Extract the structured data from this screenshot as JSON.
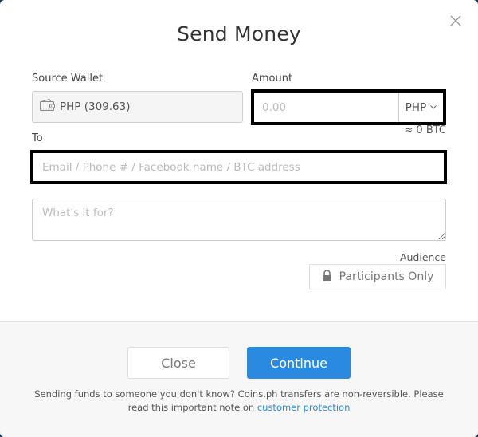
{
  "modal": {
    "title": "Send Money",
    "close_icon": "close-icon"
  },
  "form": {
    "source_wallet": {
      "label": "Source Wallet",
      "icon": "wallet-icon",
      "value": "PHP (309.63)"
    },
    "amount": {
      "label": "Amount",
      "placeholder": "0.00",
      "value": "",
      "currency": "PHP",
      "currency_icon": "chevron-down-icon",
      "btc_approx": "≈ 0 BTC"
    },
    "to": {
      "label": "To",
      "placeholder": "Email / Phone # / Facebook name / BTC address",
      "value": ""
    },
    "note": {
      "placeholder": "What's it for?",
      "value": ""
    },
    "audience": {
      "label": "Audience",
      "icon": "lock-icon",
      "value": "Participants Only"
    }
  },
  "footer": {
    "close_label": "Close",
    "continue_label": "Continue",
    "disclaimer_text": "Sending funds to someone you don't know? Coins.ph transfers are non-reversible. Please read this important note on ",
    "disclaimer_link": "customer protection"
  },
  "colors": {
    "primary": "#2a8ae0",
    "footer_bg": "#f7f7f7",
    "highlight_border": "#000000"
  }
}
